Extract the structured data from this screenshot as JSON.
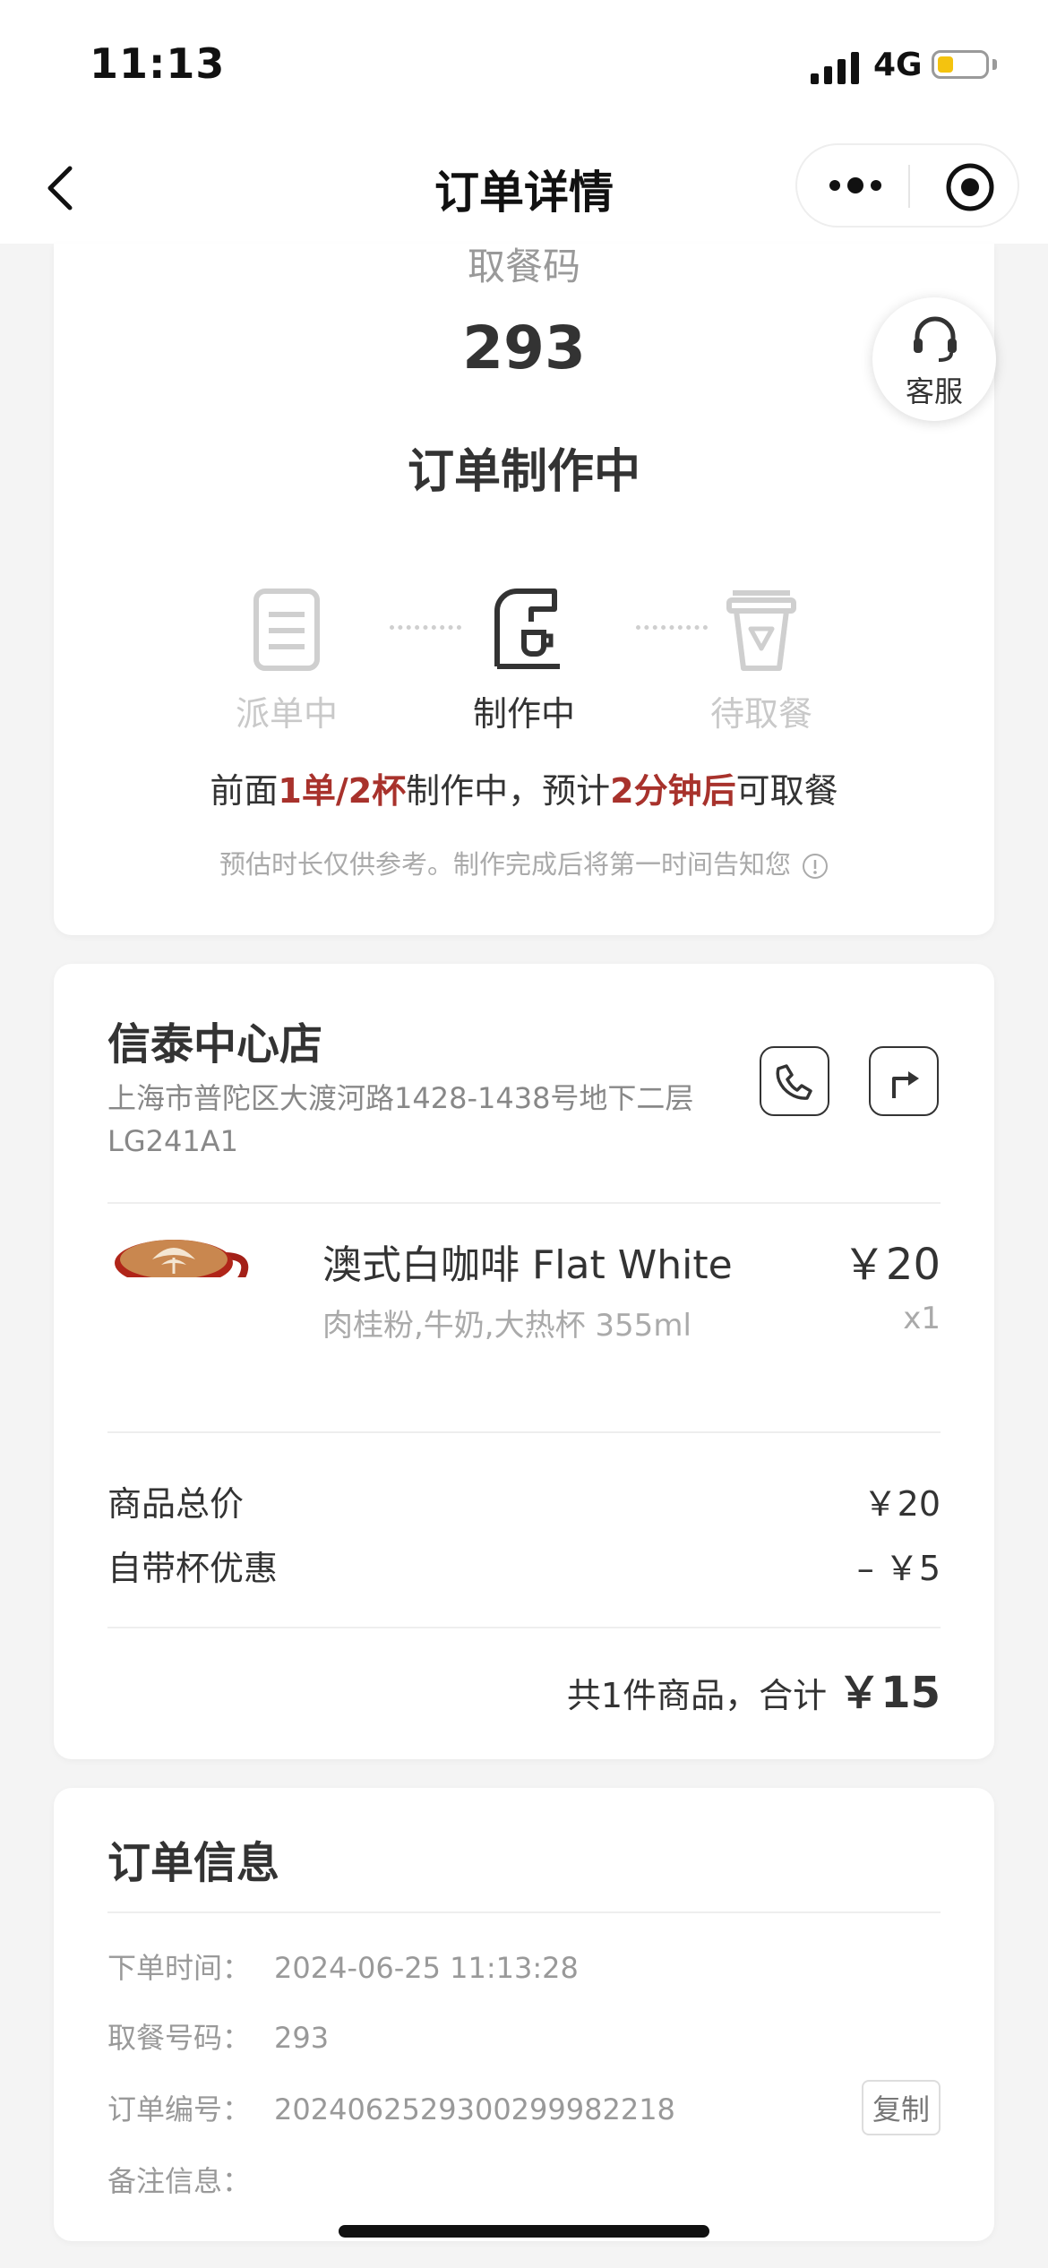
{
  "status_bar": {
    "time": "11:13",
    "network": "4G"
  },
  "nav": {
    "title": "订单详情"
  },
  "pickup": {
    "label": "取餐码",
    "code": "293",
    "status": "订单制作中",
    "customer_service": "客服"
  },
  "steps": [
    {
      "label": "派单中",
      "state": "inactive"
    },
    {
      "label": "制作中",
      "state": "active"
    },
    {
      "label": "待取餐",
      "state": "inactive"
    }
  ],
  "eta": {
    "prefix": "前面",
    "queue": "1单/2杯",
    "middle": "制作中，预计",
    "time": "2分钟后",
    "suffix": "可取餐",
    "note": "预估时长仅供参考。制作完成后将第一时间告知您"
  },
  "store": {
    "name": "信泰中心店",
    "address": "上海市普陀区大渡河路1428-1438号地下二层LG241A1"
  },
  "product": {
    "name": "澳式白咖啡 Flat White",
    "options": "肉桂粉,牛奶,大热杯 355ml",
    "price": "￥20",
    "qty": "x1"
  },
  "fees": {
    "subtotal_label": "商品总价",
    "subtotal_value": "￥20",
    "discount_label": "自带杯优惠",
    "discount_value": "– ￥5",
    "total_prefix": "共1件商品，合计",
    "total_value": "￥15"
  },
  "order_info": {
    "title": "订单信息",
    "rows": [
      {
        "key": "下单时间：",
        "value": "2024-06-25 11:13:28"
      },
      {
        "key": "取餐号码：",
        "value": "293"
      },
      {
        "key": "订单编号：",
        "value": "20240625293002999822​18"
      },
      {
        "key": "备注信息：",
        "value": ""
      }
    ],
    "copy_label": "复制"
  },
  "colors": {
    "accent": "#a8322c",
    "muted": "#c9c9c9",
    "text": "#333333"
  }
}
